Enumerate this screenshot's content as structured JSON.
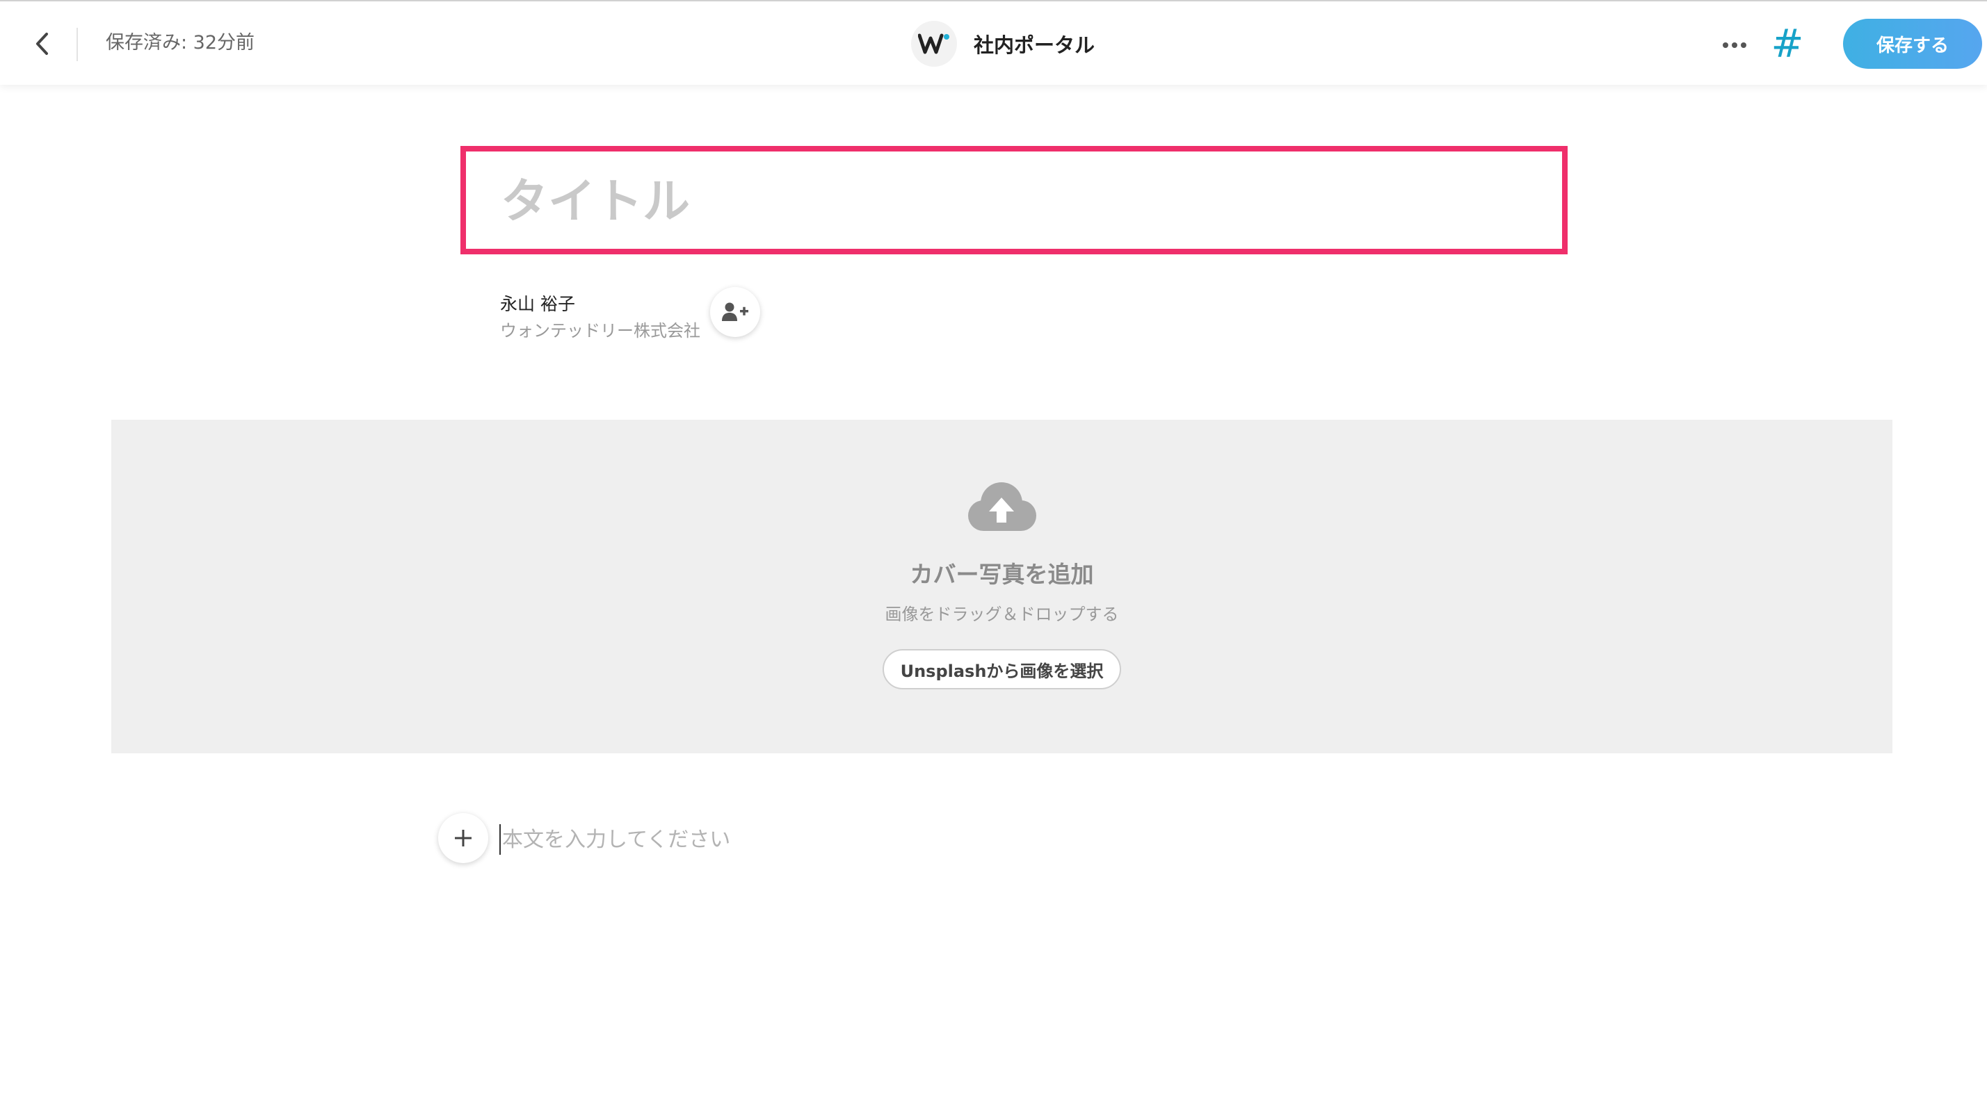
{
  "header": {
    "back_icon": "chevron-left-icon",
    "saved_status": "保存済み: 32分前",
    "brand_icon": "wantedly-logo",
    "brand_name": "社内ポータル",
    "more_icon": "more-horizontal-icon",
    "hashtag_label": "#",
    "save_label": "保存する"
  },
  "title": {
    "placeholder": "タイトル",
    "value": ""
  },
  "author": {
    "name": "永山 裕子",
    "company": "ウォンテッドリー株式会社",
    "add_icon": "user-plus-icon"
  },
  "cover": {
    "icon": "cloud-upload-icon",
    "title": "カバー写真を追加",
    "subtitle": "画像をドラッグ＆ドロップする",
    "unsplash_label": "Unsplashから画像を選択"
  },
  "body": {
    "add_icon": "plus-icon",
    "placeholder": "本文を入力してください",
    "value": ""
  },
  "colors": {
    "accent_highlight": "#ef2f6b",
    "hashtag": "#17a2c8",
    "save_button": "#4aabe9",
    "cover_background": "#efefef"
  }
}
